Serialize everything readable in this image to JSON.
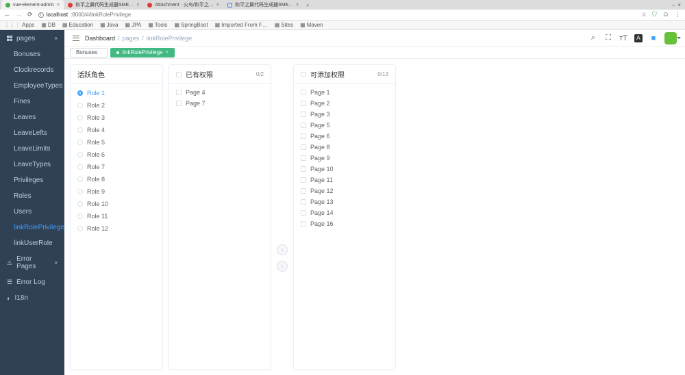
{
  "browser": {
    "tabs": [
      {
        "title": "vue-element-admin",
        "fav": "fav-green",
        "active": true
      },
      {
        "title": "和平之翼代码生成器SME…",
        "fav": "fav-red",
        "active": false
      },
      {
        "title": "Attachment · 火鸟/和平之…",
        "fav": "fav-red",
        "active": false
      },
      {
        "title": "和平之翼代码生成器SME…",
        "fav": "fav-blue",
        "active": false
      }
    ],
    "newTab": "+",
    "windowClose": "×",
    "nav": {
      "back": "←",
      "fwd": "→",
      "reload": "⟳"
    },
    "urlHost": "localhost",
    "urlRest": ":8000/#/linkRolePrivilege",
    "right": {
      "star": "☆",
      "ext": "⛉",
      "menu": "⋮"
    },
    "bookmarks": [
      {
        "icon": "⋮⋮⋮",
        "label": "Apps"
      },
      {
        "icon": "▦",
        "label": "DB"
      },
      {
        "icon": "▦",
        "label": "Education"
      },
      {
        "icon": "▦",
        "label": "Java"
      },
      {
        "icon": "▦",
        "label": "JPA"
      },
      {
        "icon": "▦",
        "label": "Tools"
      },
      {
        "icon": "▦",
        "label": "SpringBoot"
      },
      {
        "icon": "▦",
        "label": "Imported From F…"
      },
      {
        "icon": "▦",
        "label": "Sites"
      },
      {
        "icon": "▦",
        "label": "Maven"
      }
    ]
  },
  "sidebar": {
    "top": {
      "label": "pages",
      "chev": "˄"
    },
    "items": [
      {
        "label": "Bonuses"
      },
      {
        "label": "Clockrecords"
      },
      {
        "label": "EmployeeTypes"
      },
      {
        "label": "Fines"
      },
      {
        "label": "Leaves"
      },
      {
        "label": "LeaveLefts"
      },
      {
        "label": "LeaveLimits"
      },
      {
        "label": "LeaveTypes"
      },
      {
        "label": "Privileges"
      },
      {
        "label": "Roles"
      },
      {
        "label": "Users"
      },
      {
        "label": "linkRolePrivilege",
        "active": true
      },
      {
        "label": "linkUserRole"
      }
    ],
    "sections": [
      {
        "icon": "⚠",
        "label": "Error Pages",
        "chev": "˅"
      },
      {
        "icon": "☰",
        "label": "Error Log"
      },
      {
        "icon": "◐",
        "label": "I18n"
      }
    ]
  },
  "topbar": {
    "crumbs": [
      "Dashboard",
      "pages",
      "linkRolePrivilege"
    ],
    "icons": {
      "search": "⌕",
      "fullscreen": "⛶",
      "size": "тT",
      "lang": "Ａ",
      "theme": "■"
    },
    "themeColor": "#409EFF",
    "avatarColor": "#67c23a"
  },
  "tags": [
    {
      "label": "Bonuses",
      "active": false,
      "closable": false
    },
    {
      "label": "linkRolePrivilege",
      "active": true,
      "closable": true
    }
  ],
  "transfer": {
    "rolesTitle": "活跃角色",
    "roles": [
      {
        "label": "Role 1",
        "selected": true
      },
      {
        "label": "Role 2"
      },
      {
        "label": "Role 3"
      },
      {
        "label": "Role 4"
      },
      {
        "label": "Role 5"
      },
      {
        "label": "Role 6"
      },
      {
        "label": "Role 7"
      },
      {
        "label": "Role 8"
      },
      {
        "label": "Role 9"
      },
      {
        "label": "Role 10"
      },
      {
        "label": "Role 11"
      },
      {
        "label": "Role 12"
      }
    ],
    "assigned": {
      "title": "已有权限",
      "count": "0/2",
      "items": [
        "Page 4",
        "Page 7"
      ]
    },
    "available": {
      "title": "可添加权限",
      "count": "0/13",
      "items": [
        "Page 1",
        "Page 2",
        "Page 3",
        "Page 5",
        "Page 6",
        "Page 8",
        "Page 9",
        "Page 10",
        "Page 11",
        "Page 12",
        "Page 13",
        "Page 14",
        "Page 16"
      ]
    },
    "arrowLeft": "‹",
    "arrowRight": "›"
  }
}
